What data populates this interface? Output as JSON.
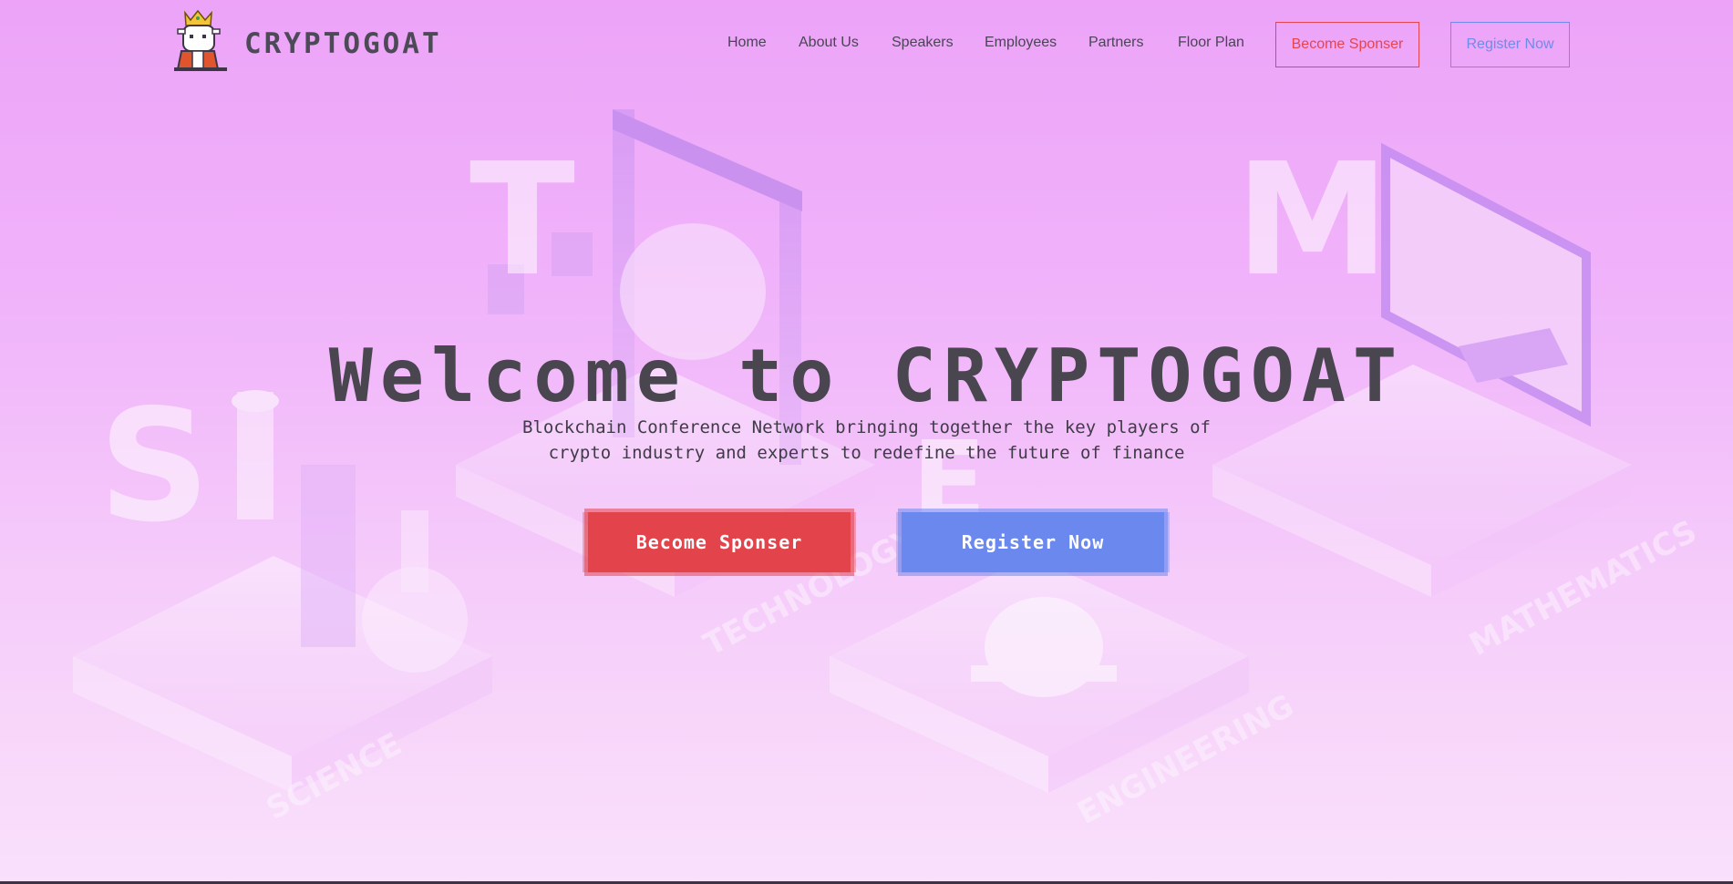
{
  "header": {
    "brand": "CRYPTOGOAT",
    "nav": [
      {
        "label": "Home"
      },
      {
        "label": "About Us"
      },
      {
        "label": "Speakers"
      },
      {
        "label": "Employees"
      },
      {
        "label": "Partners"
      },
      {
        "label": "Floor Plan"
      }
    ],
    "sponsor_label": "Become Sponser",
    "register_label": "Register Now"
  },
  "hero": {
    "title": "Welcome to CRYPTOGOAT",
    "subtitle_line1": "Blockchain Conference Network bringing together the key players of",
    "subtitle_line2": "crypto industry and experts to redefine the future of finance",
    "sponsor_label": "Become Sponser",
    "register_label": "Register Now"
  },
  "background": {
    "letters": [
      "S",
      "T",
      "E",
      "M"
    ],
    "labels": [
      "TECHNOLOGY",
      "MATHEMATICS",
      "SCIENCE",
      "ENGINEERING"
    ]
  },
  "colors": {
    "accent_red": "#e3434a",
    "accent_blue": "#6b88ee",
    "text_dark": "#4a4650",
    "bg_top": "#eb9cf8",
    "bg_bottom": "#fbe6fc"
  },
  "icons": {
    "logo": "crowned-goat-icon"
  }
}
